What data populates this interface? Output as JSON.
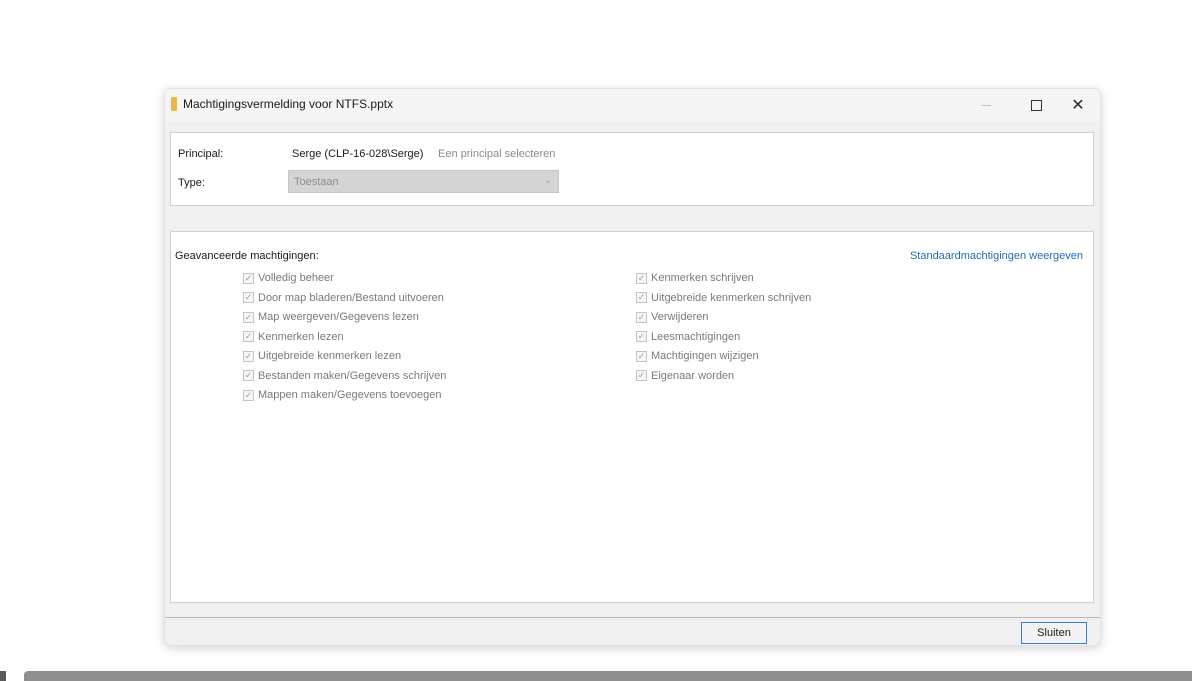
{
  "window": {
    "title": "Machtigingsvermelding voor NTFS.pptx",
    "controls": {
      "minimize": "—",
      "maximize": "☐",
      "close": "✕"
    }
  },
  "principal": {
    "label": "Principal:",
    "value": "Serge (CLP-16-028\\Serge)",
    "select_link": "Een principal selecteren"
  },
  "type": {
    "label": "Type:",
    "value": "Toestaan",
    "arrow": "⌄"
  },
  "advanced": {
    "label": "Geavanceerde machtigingen:",
    "standard_link": "Standaardmachtigingen weergeven",
    "left_column": [
      {
        "label": "Volledig beheer",
        "checked": true
      },
      {
        "label": "Door map bladeren/Bestand uitvoeren",
        "checked": true
      },
      {
        "label": "Map weergeven/Gegevens lezen",
        "checked": true
      },
      {
        "label": "Kenmerken lezen",
        "checked": true
      },
      {
        "label": "Uitgebreide kenmerken lezen",
        "checked": true
      },
      {
        "label": "Bestanden maken/Gegevens schrijven",
        "checked": true
      },
      {
        "label": "Mappen maken/Gegevens toevoegen",
        "checked": true
      }
    ],
    "right_column": [
      {
        "label": "Kenmerken schrijven",
        "checked": true
      },
      {
        "label": "Uitgebreide kenmerken schrijven",
        "checked": true
      },
      {
        "label": "Verwijderen",
        "checked": true
      },
      {
        "label": "Leesmachtigingen",
        "checked": true
      },
      {
        "label": "Machtigingen wijzigen",
        "checked": true
      },
      {
        "label": "Eigenaar worden",
        "checked": true
      }
    ],
    "check_glyph": "✓"
  },
  "footer": {
    "close_label": "Sluiten"
  },
  "colors": {
    "link": "#1a6fb8",
    "folder_icon": "#e8b94a",
    "button_focus_border": "#3b7fcc"
  }
}
